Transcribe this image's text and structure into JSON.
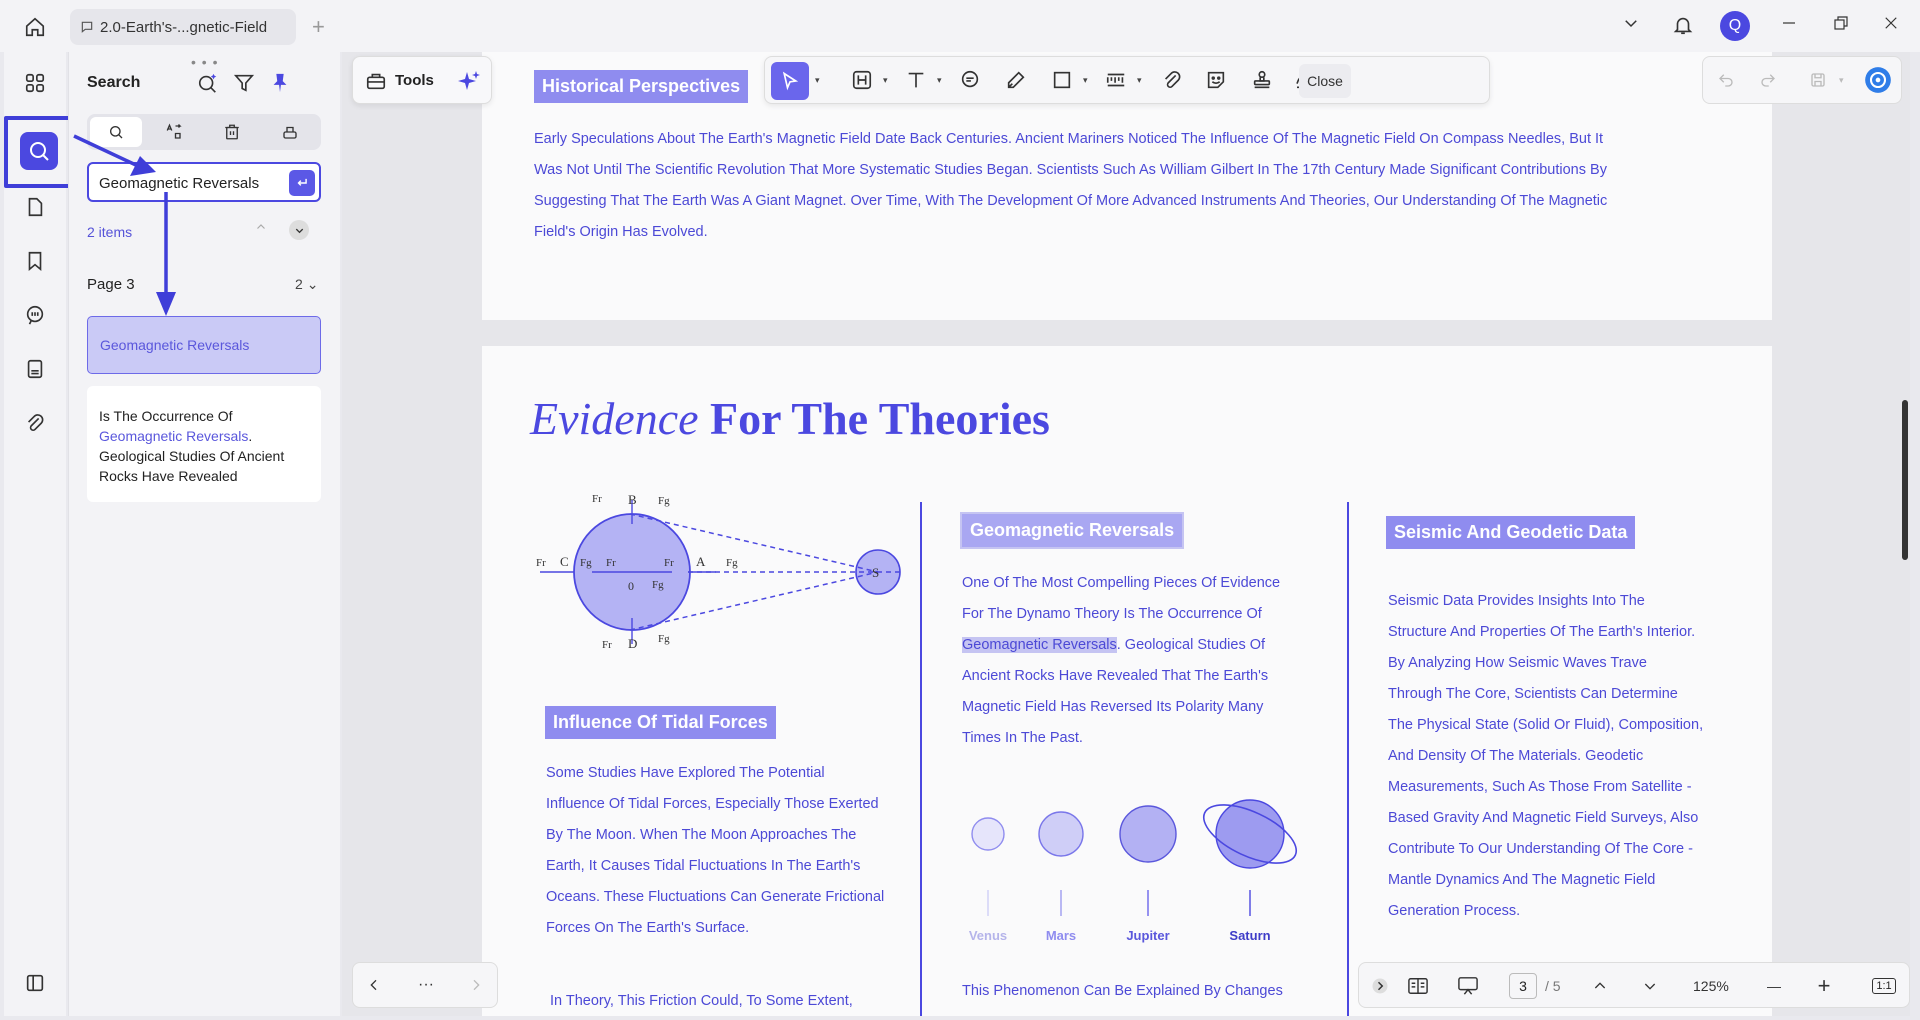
{
  "titlebar": {
    "tab_title": "2.0-Earth's-...gnetic-Field",
    "add_tab": "+",
    "avatar_letter": "Q"
  },
  "panel": {
    "title": "Search",
    "drag_dots": "• • •",
    "search_value": "Geomagnetic Reversals",
    "count": "2 items",
    "page_label": "Page 3",
    "page_count": "2",
    "result_text": "Geomagnetic Reversals",
    "context_before": "Is The Occurrence Of",
    "context_match": "Geomagnetic Reversals",
    "context_after": ". Geological Studies Of Ancient Rocks Have Revealed"
  },
  "toolbar": {
    "tools_label": "Tools",
    "close_label": "Close"
  },
  "page1": {
    "heading": "Historical Perspectives",
    "paragraph_lines": [
      "Early Speculations About The Earth's Magnetic Field Date Back Centuries. Ancient Mariners Noticed The Influence Of The Magnetic Field On Compass Needles, But It",
      "Was Not Until The Scientific Revolution That More Systematic Studies Began. Scientists Such As William Gilbert In The 17th Century Made Significant Contributions By",
      "Suggesting That The Earth Was A Giant Magnet. Over Time, With The Development Of More Advanced Instruments And Theories, Our Understanding Of The Magnetic",
      "Field's Origin Has Evolved."
    ]
  },
  "page2": {
    "title_italic": "Evidence",
    "title_bold": " For The Theories",
    "diagram_labels": {
      "b": "B",
      "c": "C",
      "d": "D",
      "a": "A",
      "s": "S",
      "zero": "0",
      "fr": "Fr",
      "fg": "Fg"
    },
    "col1": {
      "heading": "Influence Of Tidal Forces",
      "lines": [
        "Some Studies Have Explored The Potential",
        "Influence Of Tidal Forces, Especially Those Exerted",
        "By The Moon. When The Moon Approaches The",
        "Earth, It Causes Tidal Fluctuations In The Earth's",
        "Oceans. These Fluctuations Can Generate Frictional",
        "Forces On The Earth's Surface."
      ],
      "next_line": "In Theory, This Friction Could, To Some Extent,"
    },
    "col2": {
      "heading": "Geomagnetic Reversals",
      "lines": [
        "One Of The Most Compelling Pieces Of Evidence",
        "For The Dynamo Theory Is The Occurrence Of",
        "Geomagnetic Reversals",
        ". Geological Studies Of",
        "Ancient Rocks Have Revealed That The Earth's",
        "Magnetic Field Has Reversed Its Polarity Many",
        "Times In The Past."
      ],
      "planets": [
        "Venus",
        "Mars",
        "Jupiter",
        "Saturn"
      ],
      "next_line": "This Phenomenon Can Be Explained By Changes"
    },
    "col3": {
      "heading": "Seismic And Geodetic Data",
      "lines": [
        "Seismic Data Provides Insights Into The",
        "Structure And Properties Of The Earth's Interior.",
        "By Analyzing How Seismic Waves Trave",
        "Through The Core, Scientists Can Determine",
        "The Physical State (Solid Or Fluid), Composition,",
        "And Density Of The Materials. Geodetic",
        "Measurements, Such As Those From Satellite -",
        "Based Gravity And Magnetic Field Surveys, Also",
        "Contribute To Our Understanding Of The Core -",
        "Mantle Dynamics And The Magnetic Field",
        "Generation Process."
      ]
    }
  },
  "bottom": {
    "more": "···",
    "page_current": "3",
    "page_total": "/ 5",
    "zoom": "125%",
    "minus": "—",
    "plus": "+",
    "fit": "1:1"
  },
  "colors": {
    "accent": "#4b48e0",
    "heading_band": "#8f8cef",
    "highlight": "#c5c4f2"
  }
}
